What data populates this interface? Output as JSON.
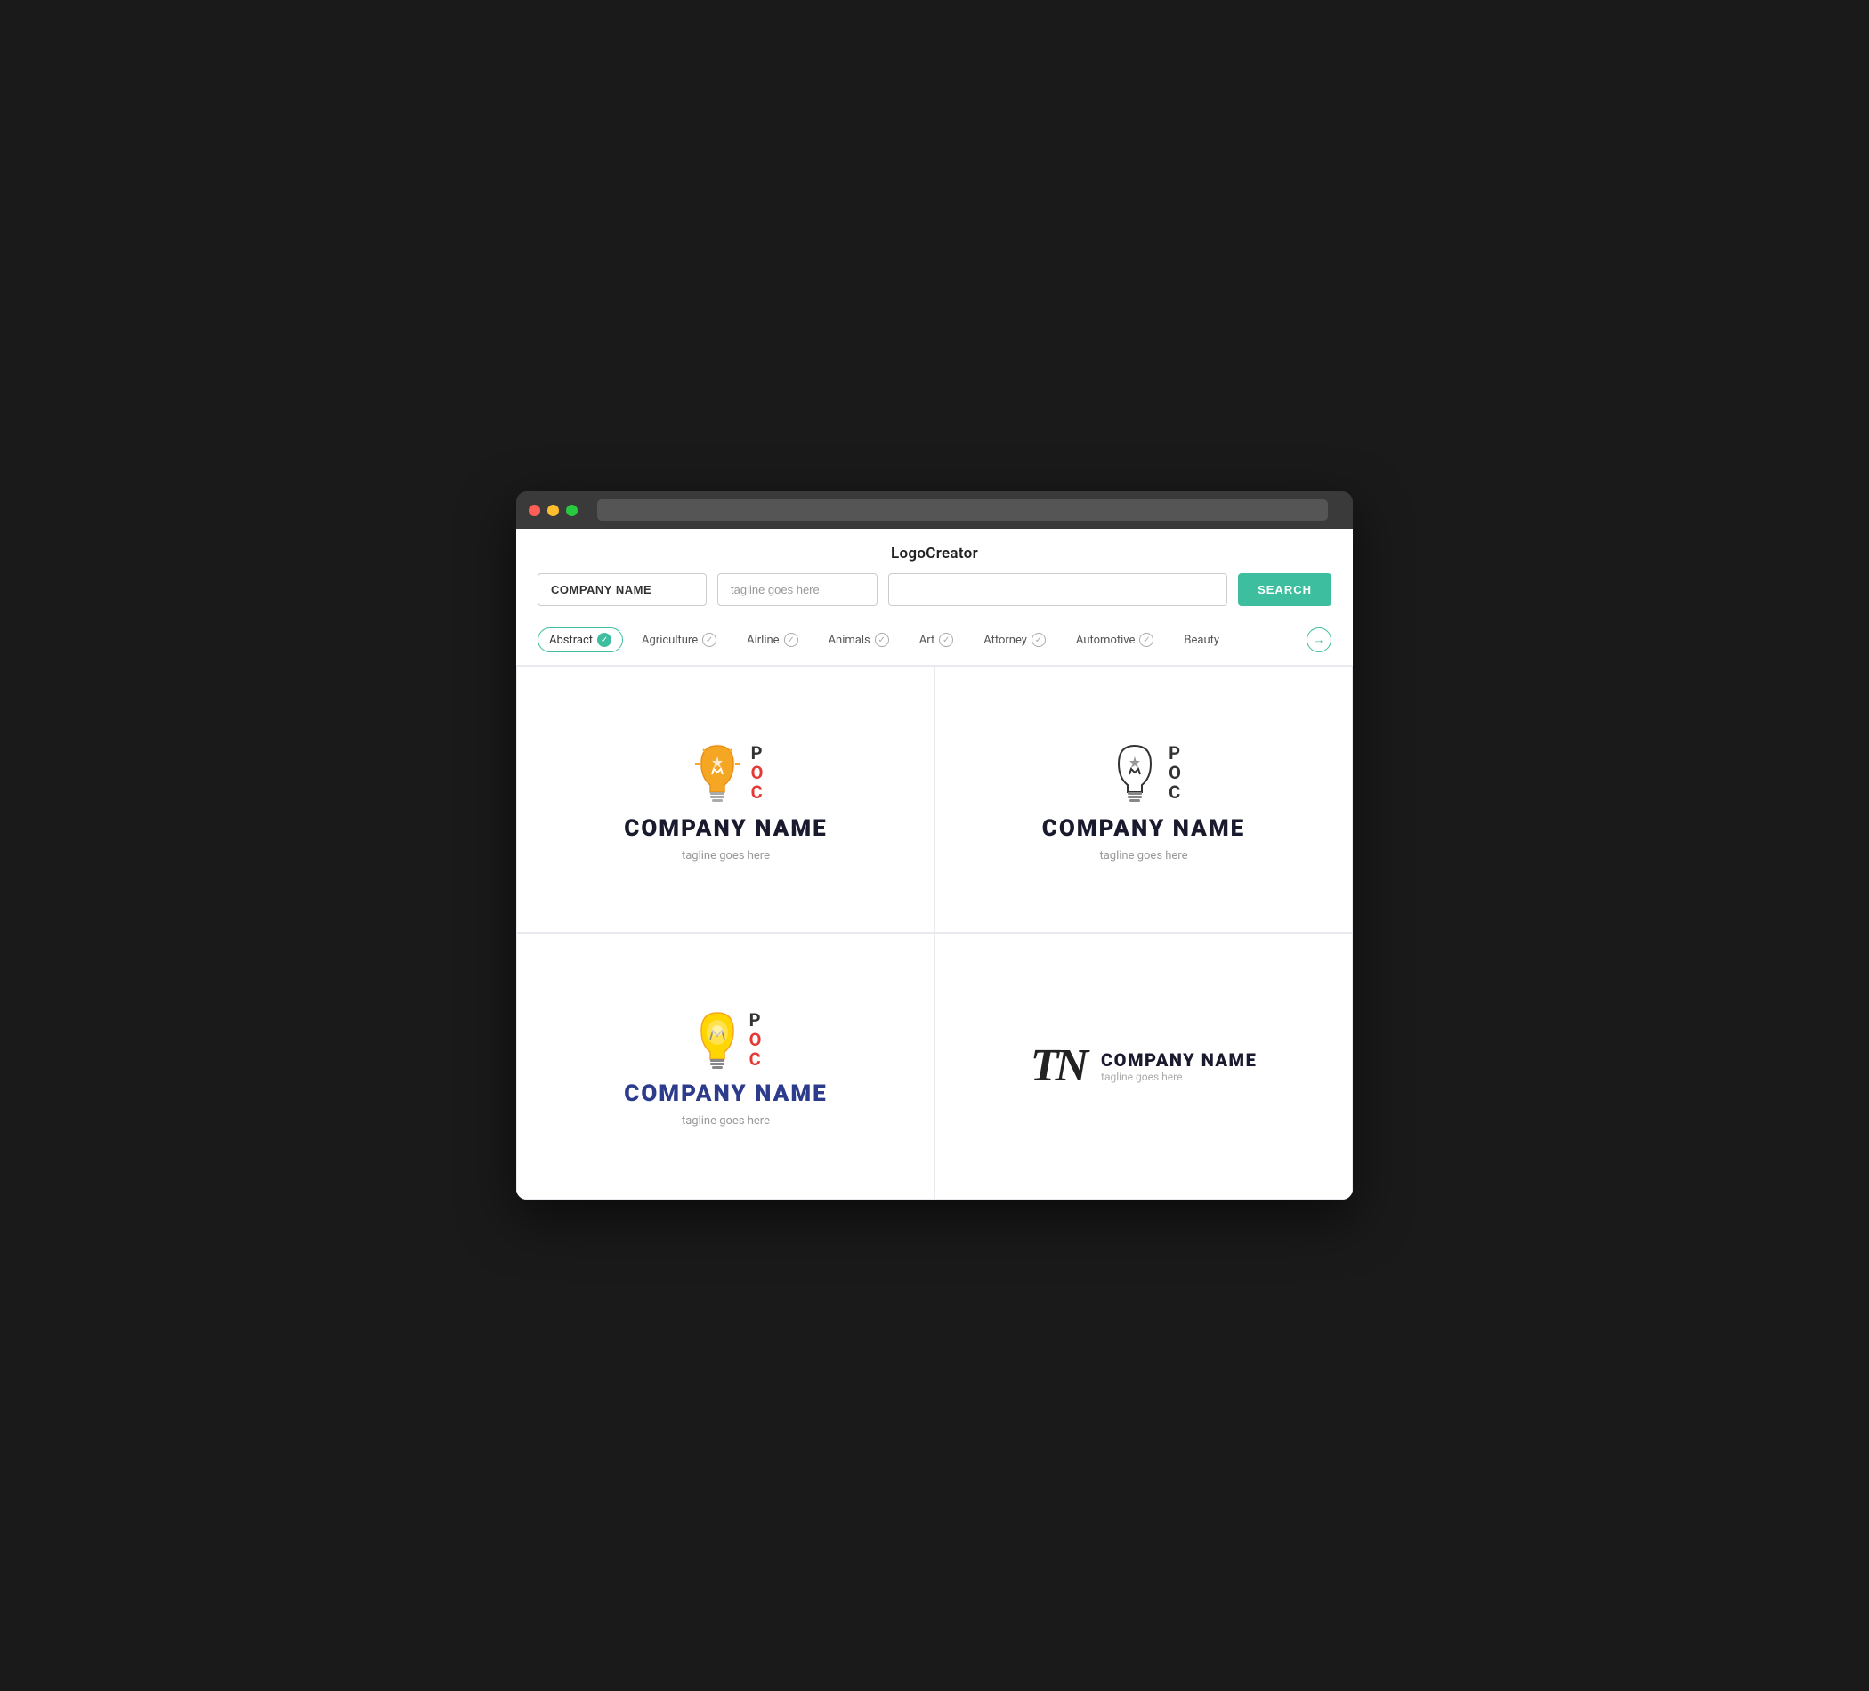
{
  "app": {
    "title": "LogoCreator"
  },
  "search": {
    "company_placeholder": "COMPANY NAME",
    "tagline_placeholder": "tagline goes here",
    "extra_placeholder": "",
    "button_label": "SEARCH"
  },
  "categories": [
    {
      "label": "Abstract",
      "active": true
    },
    {
      "label": "Agriculture",
      "active": false
    },
    {
      "label": "Airline",
      "active": false
    },
    {
      "label": "Animals",
      "active": false
    },
    {
      "label": "Art",
      "active": false
    },
    {
      "label": "Attorney",
      "active": false
    },
    {
      "label": "Automotive",
      "active": false
    },
    {
      "label": "Beauty",
      "active": false
    }
  ],
  "logos": [
    {
      "type": "colored-bulb",
      "company": "COMPANY NAME",
      "tagline": "tagline goes here"
    },
    {
      "type": "outline-bulb",
      "company": "COMPANY NAME",
      "tagline": "tagline goes here"
    },
    {
      "type": "yellow-bulb",
      "company": "COMPANY NAME",
      "tagline": "tagline goes here"
    },
    {
      "type": "tn-mono",
      "company": "COMPANY NAME",
      "tagline": "tagline goes here"
    }
  ],
  "colors": {
    "accent": "#3dbf9f",
    "dark_text": "#1a1a2e",
    "blue_text": "#2c3b8c"
  }
}
